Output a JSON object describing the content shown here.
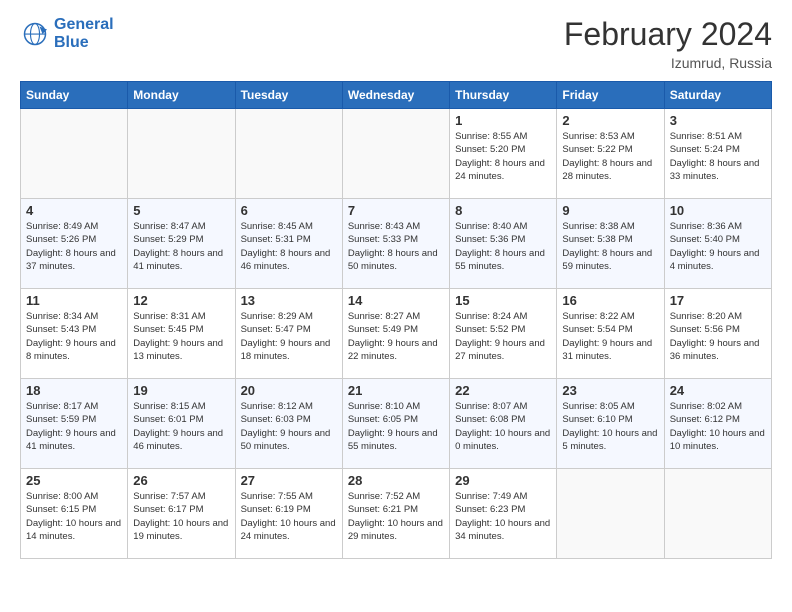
{
  "header": {
    "logo_line1": "General",
    "logo_line2": "Blue",
    "month_year": "February 2024",
    "location": "Izumrud, Russia"
  },
  "days_of_week": [
    "Sunday",
    "Monday",
    "Tuesday",
    "Wednesday",
    "Thursday",
    "Friday",
    "Saturday"
  ],
  "weeks": [
    {
      "days": [
        {
          "num": "",
          "empty": true
        },
        {
          "num": "",
          "empty": true
        },
        {
          "num": "",
          "empty": true
        },
        {
          "num": "",
          "empty": true
        },
        {
          "num": "1",
          "sunrise": "8:55 AM",
          "sunset": "5:20 PM",
          "daylight": "8 hours and 24 minutes."
        },
        {
          "num": "2",
          "sunrise": "8:53 AM",
          "sunset": "5:22 PM",
          "daylight": "8 hours and 28 minutes."
        },
        {
          "num": "3",
          "sunrise": "8:51 AM",
          "sunset": "5:24 PM",
          "daylight": "8 hours and 33 minutes."
        }
      ]
    },
    {
      "days": [
        {
          "num": "4",
          "sunrise": "8:49 AM",
          "sunset": "5:26 PM",
          "daylight": "8 hours and 37 minutes."
        },
        {
          "num": "5",
          "sunrise": "8:47 AM",
          "sunset": "5:29 PM",
          "daylight": "8 hours and 41 minutes."
        },
        {
          "num": "6",
          "sunrise": "8:45 AM",
          "sunset": "5:31 PM",
          "daylight": "8 hours and 46 minutes."
        },
        {
          "num": "7",
          "sunrise": "8:43 AM",
          "sunset": "5:33 PM",
          "daylight": "8 hours and 50 minutes."
        },
        {
          "num": "8",
          "sunrise": "8:40 AM",
          "sunset": "5:36 PM",
          "daylight": "8 hours and 55 minutes."
        },
        {
          "num": "9",
          "sunrise": "8:38 AM",
          "sunset": "5:38 PM",
          "daylight": "8 hours and 59 minutes."
        },
        {
          "num": "10",
          "sunrise": "8:36 AM",
          "sunset": "5:40 PM",
          "daylight": "9 hours and 4 minutes."
        }
      ]
    },
    {
      "days": [
        {
          "num": "11",
          "sunrise": "8:34 AM",
          "sunset": "5:43 PM",
          "daylight": "9 hours and 8 minutes."
        },
        {
          "num": "12",
          "sunrise": "8:31 AM",
          "sunset": "5:45 PM",
          "daylight": "9 hours and 13 minutes."
        },
        {
          "num": "13",
          "sunrise": "8:29 AM",
          "sunset": "5:47 PM",
          "daylight": "9 hours and 18 minutes."
        },
        {
          "num": "14",
          "sunrise": "8:27 AM",
          "sunset": "5:49 PM",
          "daylight": "9 hours and 22 minutes."
        },
        {
          "num": "15",
          "sunrise": "8:24 AM",
          "sunset": "5:52 PM",
          "daylight": "9 hours and 27 minutes."
        },
        {
          "num": "16",
          "sunrise": "8:22 AM",
          "sunset": "5:54 PM",
          "daylight": "9 hours and 31 minutes."
        },
        {
          "num": "17",
          "sunrise": "8:20 AM",
          "sunset": "5:56 PM",
          "daylight": "9 hours and 36 minutes."
        }
      ]
    },
    {
      "days": [
        {
          "num": "18",
          "sunrise": "8:17 AM",
          "sunset": "5:59 PM",
          "daylight": "9 hours and 41 minutes."
        },
        {
          "num": "19",
          "sunrise": "8:15 AM",
          "sunset": "6:01 PM",
          "daylight": "9 hours and 46 minutes."
        },
        {
          "num": "20",
          "sunrise": "8:12 AM",
          "sunset": "6:03 PM",
          "daylight": "9 hours and 50 minutes."
        },
        {
          "num": "21",
          "sunrise": "8:10 AM",
          "sunset": "6:05 PM",
          "daylight": "9 hours and 55 minutes."
        },
        {
          "num": "22",
          "sunrise": "8:07 AM",
          "sunset": "6:08 PM",
          "daylight": "10 hours and 0 minutes."
        },
        {
          "num": "23",
          "sunrise": "8:05 AM",
          "sunset": "6:10 PM",
          "daylight": "10 hours and 5 minutes."
        },
        {
          "num": "24",
          "sunrise": "8:02 AM",
          "sunset": "6:12 PM",
          "daylight": "10 hours and 10 minutes."
        }
      ]
    },
    {
      "days": [
        {
          "num": "25",
          "sunrise": "8:00 AM",
          "sunset": "6:15 PM",
          "daylight": "10 hours and 14 minutes."
        },
        {
          "num": "26",
          "sunrise": "7:57 AM",
          "sunset": "6:17 PM",
          "daylight": "10 hours and 19 minutes."
        },
        {
          "num": "27",
          "sunrise": "7:55 AM",
          "sunset": "6:19 PM",
          "daylight": "10 hours and 24 minutes."
        },
        {
          "num": "28",
          "sunrise": "7:52 AM",
          "sunset": "6:21 PM",
          "daylight": "10 hours and 29 minutes."
        },
        {
          "num": "29",
          "sunrise": "7:49 AM",
          "sunset": "6:23 PM",
          "daylight": "10 hours and 34 minutes."
        },
        {
          "num": "",
          "empty": true
        },
        {
          "num": "",
          "empty": true
        }
      ]
    }
  ],
  "labels": {
    "sunrise": "Sunrise:",
    "sunset": "Sunset:",
    "daylight": "Daylight:"
  }
}
